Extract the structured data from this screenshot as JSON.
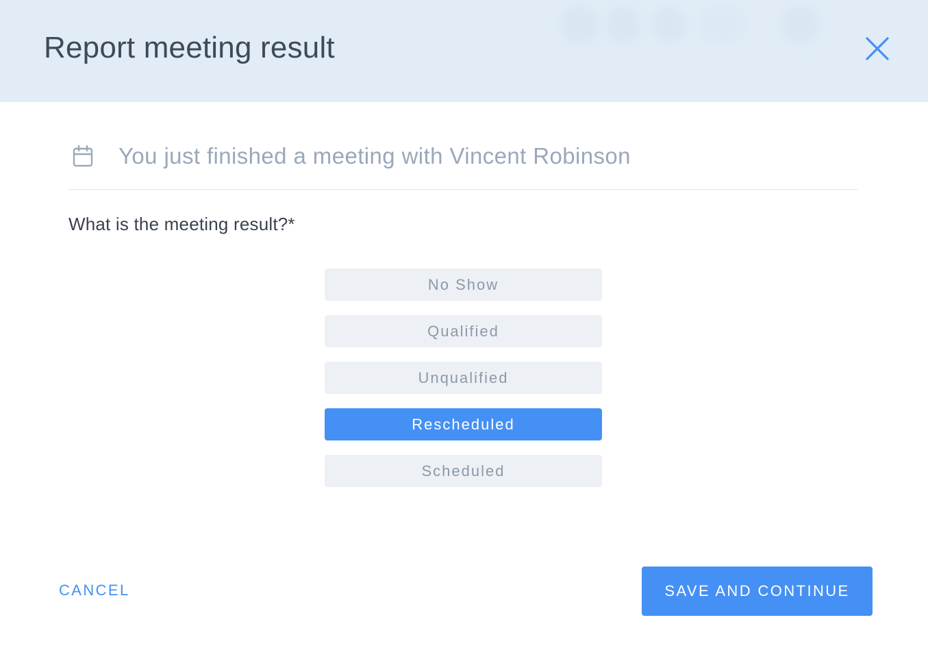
{
  "dialog": {
    "title": "Report meeting result",
    "close_icon": "close-icon"
  },
  "meeting_info": {
    "icon": "calendar-icon",
    "text": "You just finished a meeting with Vincent Robinson"
  },
  "question": {
    "label": "What is the meeting result?*"
  },
  "options": [
    {
      "label": "No Show",
      "selected": false
    },
    {
      "label": "Qualified",
      "selected": false
    },
    {
      "label": "Unqualified",
      "selected": false
    },
    {
      "label": "Rescheduled",
      "selected": true
    },
    {
      "label": "Scheduled",
      "selected": false
    }
  ],
  "footer": {
    "cancel_label": "CANCEL",
    "save_label": "SAVE AND CONTINUE"
  },
  "colors": {
    "accent": "#4590f4",
    "header_bg": "#e1ecf7",
    "option_bg": "#edf0f4"
  }
}
